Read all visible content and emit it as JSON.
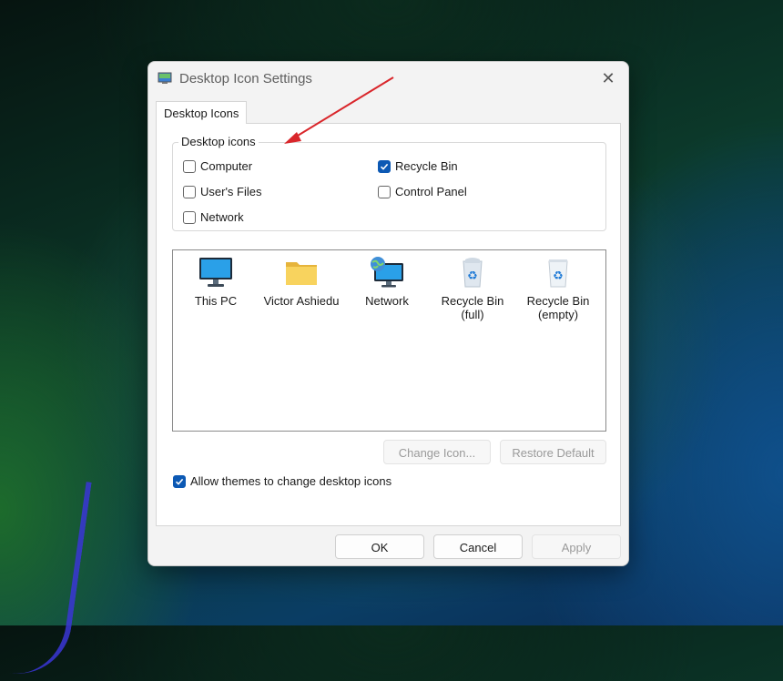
{
  "window": {
    "title": "Desktop Icon Settings",
    "close_icon": "close-icon"
  },
  "tabs": [
    {
      "label": "Desktop Icons",
      "selected": true
    }
  ],
  "desktop_icons_group": {
    "label": "Desktop icons",
    "checkboxes": [
      {
        "label": "Computer",
        "checked": false
      },
      {
        "label": "Recycle Bin",
        "checked": true
      },
      {
        "label": "User's Files",
        "checked": false
      },
      {
        "label": "Control Panel",
        "checked": false
      },
      {
        "label": "Network",
        "checked": false
      }
    ]
  },
  "icon_list": [
    {
      "label": "This PC",
      "icon": "monitor-icon"
    },
    {
      "label": "Victor Ashiedu",
      "icon": "folder-icon"
    },
    {
      "label": "Network",
      "icon": "network-globe-icon"
    },
    {
      "label": "Recycle Bin\n(full)",
      "icon": "recycle-bin-full-icon"
    },
    {
      "label": "Recycle Bin\n(empty)",
      "icon": "recycle-bin-empty-icon"
    }
  ],
  "actions": {
    "change_icon": "Change Icon...",
    "restore_default": "Restore Default"
  },
  "allow_themes": {
    "label": "Allow themes to change desktop icons",
    "checked": true
  },
  "footer": {
    "ok": "OK",
    "cancel": "Cancel",
    "apply": "Apply"
  },
  "annotation": {
    "color": "#d9262b"
  },
  "colors": {
    "accent": "#0c59b4"
  }
}
